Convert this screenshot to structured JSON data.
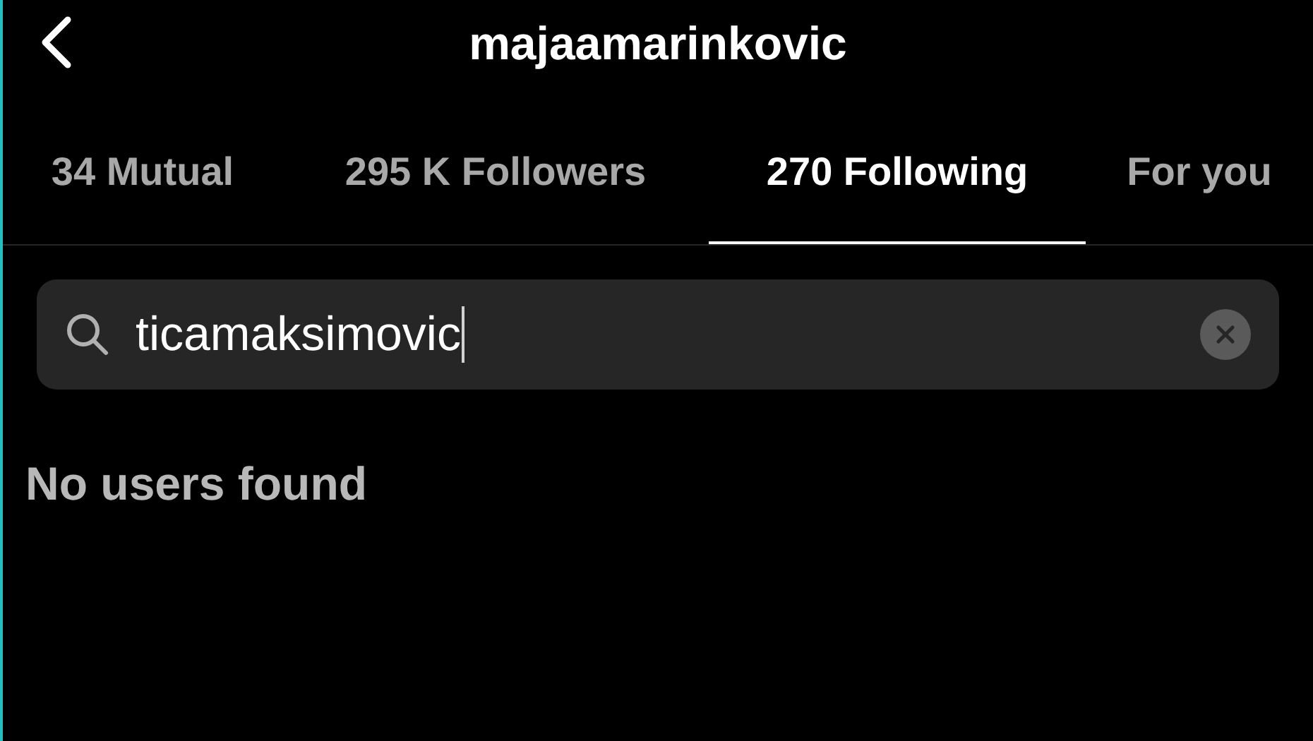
{
  "header": {
    "title": "majaamarinkovic"
  },
  "tabs": [
    {
      "label": "34 Mutual",
      "selected": false
    },
    {
      "label": "295 K Followers",
      "selected": false
    },
    {
      "label": "270 Following",
      "selected": true
    },
    {
      "label": "For you",
      "selected": false
    }
  ],
  "search": {
    "value": "ticamaksimovic"
  },
  "empty_message": "No users found"
}
